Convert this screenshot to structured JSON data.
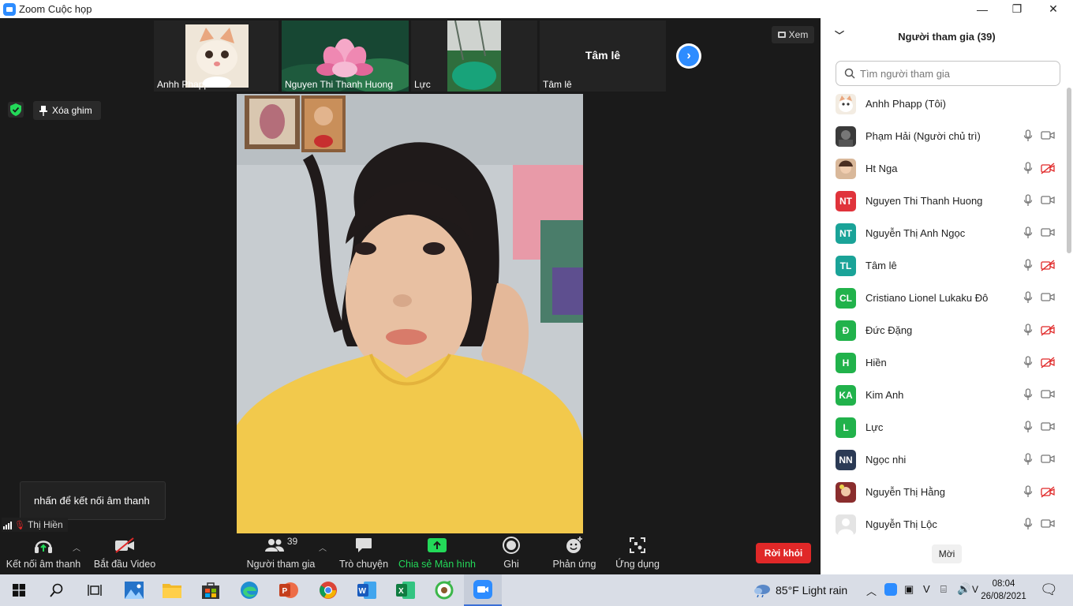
{
  "window": {
    "title": "Zoom Cuộc họp",
    "minimize": "—",
    "maximize": "❐",
    "close": "✕"
  },
  "thumbnails": [
    {
      "name": "Anhh Phapp"
    },
    {
      "name": "Nguyen Thi Thanh Huong"
    },
    {
      "name": "Lực"
    },
    {
      "name": "Tâm lê",
      "center_label": "Tâm lê"
    }
  ],
  "view_button": {
    "label": "Xem"
  },
  "unpin": {
    "label": "Xóa ghim"
  },
  "tooltip": {
    "text": "nhấn để kết nối âm thanh"
  },
  "active_speaker": {
    "name": "Thị Hiền"
  },
  "toolbar": {
    "audio": "Kết nối âm thanh",
    "video": "Bắt đầu Video",
    "participants": "Người tham gia",
    "participants_count": "39",
    "chat": "Trò chuyện",
    "share": "Chia sẻ Màn hình",
    "record": "Ghi",
    "reactions": "Phản ứng",
    "apps": "Ứng dụng",
    "leave": "Rời khỏi"
  },
  "panel": {
    "title": "Người tham gia (39)",
    "search_placeholder": "Tìm người tham gia",
    "invite": "Mời",
    "participants": [
      {
        "name": "Anhh Phapp (Tôi)",
        "initials": "",
        "avatar": "cat",
        "mic": false,
        "cam": "none"
      },
      {
        "name": "Phạm Hải (Người chủ trì)",
        "initials": "",
        "avatar": "photo-dark",
        "mic": true,
        "cam": "on"
      },
      {
        "name": "Ht Nga",
        "initials": "",
        "avatar": "photo-face",
        "mic": true,
        "cam": "off"
      },
      {
        "name": "Nguyen Thi Thanh Huong",
        "initials": "NT",
        "color": "#e0333b",
        "mic": true,
        "cam": "on"
      },
      {
        "name": "Nguyễn Thị Anh Ngọc",
        "initials": "NT",
        "color": "#1aa398",
        "mic": true,
        "cam": "on"
      },
      {
        "name": "Tâm lê",
        "initials": "TL",
        "color": "#1aa398",
        "mic": true,
        "cam": "off"
      },
      {
        "name": "Cristiano Lionel Lukaku Đô",
        "initials": "CL",
        "color": "#21b24b",
        "mic": true,
        "cam": "on"
      },
      {
        "name": "Đức Đặng",
        "initials": "Đ",
        "color": "#21b24b",
        "mic": true,
        "cam": "off"
      },
      {
        "name": "Hiền",
        "initials": "H",
        "color": "#21b24b",
        "mic": true,
        "cam": "off"
      },
      {
        "name": "Kim Anh",
        "initials": "KA",
        "color": "#21b24b",
        "mic": true,
        "cam": "on"
      },
      {
        "name": "Lực",
        "initials": "L",
        "color": "#21b24b",
        "mic": true,
        "cam": "on"
      },
      {
        "name": "Ngọc nhi",
        "initials": "NN",
        "color": "#2b3a55",
        "mic": true,
        "cam": "on"
      },
      {
        "name": "Nguyễn Thị Hằng",
        "initials": "",
        "avatar": "photo-red",
        "mic": true,
        "cam": "off"
      },
      {
        "name": "Nguyễn Thị Lộc",
        "initials": "",
        "avatar": "blank",
        "mic": true,
        "cam": "on"
      }
    ]
  },
  "taskbar": {
    "weather": "85°F  Light rain",
    "time": "08:04",
    "date": "26/08/2021"
  }
}
